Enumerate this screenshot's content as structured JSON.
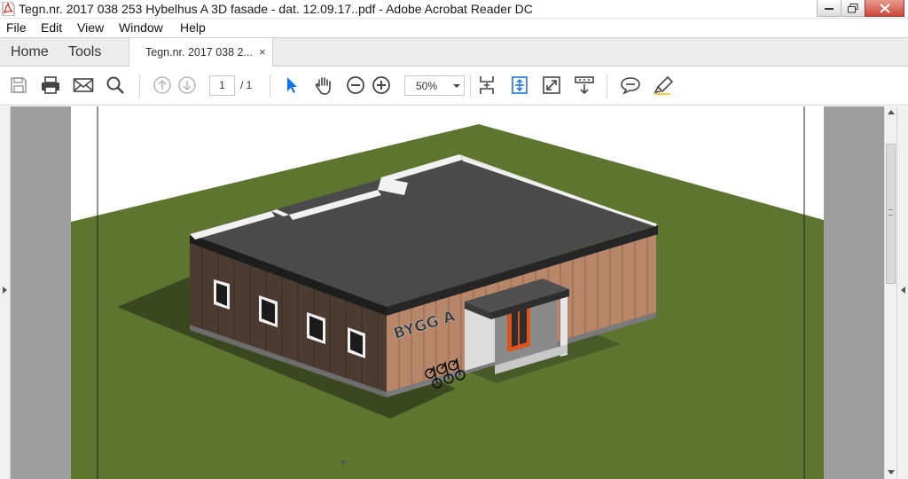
{
  "window": {
    "title": "Tegn.nr. 2017 038 253 Hybelhus A  3D fasade - dat. 12.09.17..pdf - Adobe Acrobat Reader DC",
    "app_icon": "pdf-icon"
  },
  "menu": {
    "items": [
      {
        "label": "File"
      },
      {
        "label": "Edit"
      },
      {
        "label": "View"
      },
      {
        "label": "Window"
      },
      {
        "label": "Help"
      }
    ]
  },
  "tabs": {
    "home": "Home",
    "tools": "Tools",
    "document": "Tegn.nr. 2017 038 2...",
    "close_glyph": "×"
  },
  "toolbar": {
    "icons": [
      "save-icon",
      "print-icon",
      "email-icon",
      "search-icon",
      "prev-page-icon",
      "next-page-icon",
      "select-icon",
      "hand-icon",
      "zoom-out-icon",
      "zoom-in-icon",
      "scroll-mode-icon",
      "fit-page-icon",
      "full-screen-icon",
      "read-mode-icon",
      "comment-icon",
      "highlight-icon"
    ],
    "page_current": "1",
    "page_total": "/ 1",
    "zoom": "50%"
  },
  "drawing": {
    "sign_text": "BYGG A",
    "colors": {
      "ground": "#5e7530",
      "roof": "#4a4a4a",
      "parapet": "#f2f2f2",
      "wood_cladding": "#b8876a",
      "door": "#e0551c"
    }
  }
}
